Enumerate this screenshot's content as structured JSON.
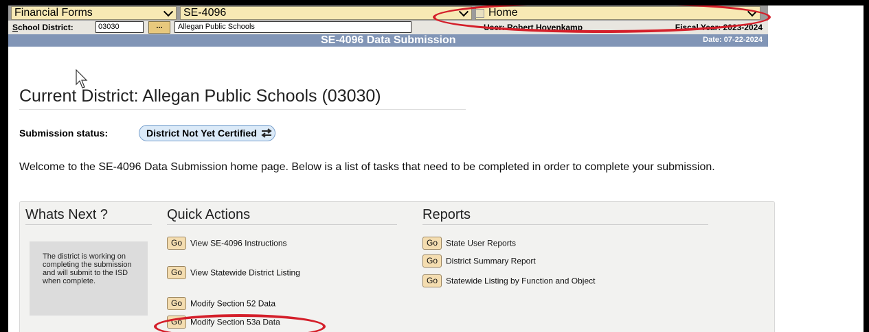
{
  "selectors": {
    "forms": "Financial Forms",
    "form": "SE-4096",
    "page": "Home"
  },
  "district_bar": {
    "label_u": "S",
    "label_rest": "chool District:",
    "code": "03030",
    "browse_label": "...",
    "name": "Allegan Public Schools",
    "user": "User: Robert Hovenkamp",
    "fiscal_year": "Fiscal Year: 2023-2024"
  },
  "title_bar": {
    "title": "SE-4096 Data Submission",
    "date": "Date: 07-22-2024"
  },
  "page": {
    "heading": "Current District: Allegan Public Schools (03030)",
    "status_label": "Submission status:",
    "status_value": "District Not Yet Certified",
    "welcome": "Welcome to the SE-4096 Data Submission home page. Below is a list of tasks that need to be completed in order to complete your submission."
  },
  "panel": {
    "whats_next_title": "Whats Next ?",
    "whats_next_text": "The district is working on completing the submission and will submit to the ISD when complete.",
    "quick_actions_title": "Quick Actions",
    "go_label": "Go",
    "quick_actions": [
      "View SE-4096 Instructions",
      "View Statewide District Listing",
      "Modify Section 52 Data",
      "Modify Section 53a Data"
    ],
    "reports_title": "Reports",
    "reports": [
      "State User Reports",
      "District Summary Report",
      "Statewide Listing by Function and Object"
    ]
  },
  "colors": {
    "annotation": "#d41f2a",
    "title_bar": "#8195b6",
    "selector_bg": "#f7e9b4",
    "go_button": "#f4ddb0"
  }
}
